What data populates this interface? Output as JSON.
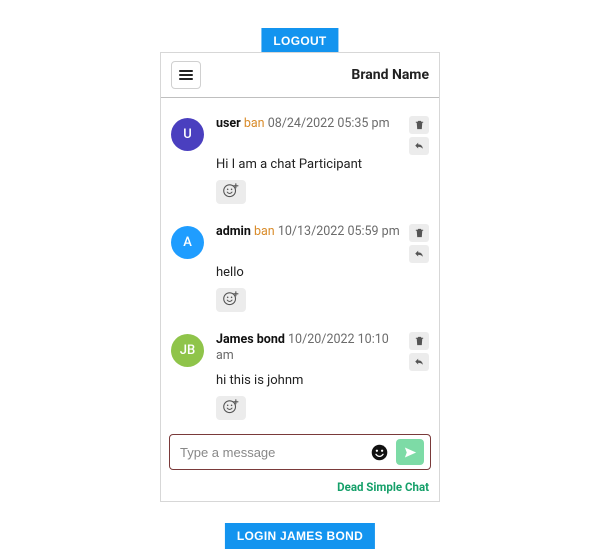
{
  "logout_label": "LOGOUT",
  "login_label": "LOGIN JAMES BOND",
  "brand": "Brand Name",
  "composer": {
    "placeholder": "Type a message"
  },
  "footer_link": "Dead Simple Chat",
  "ban_label": "ban",
  "avatar_colors": {
    "u": "#4a3fbf",
    "a": "#1f9dff",
    "jb": "#8fc44a"
  },
  "messages": [
    {
      "initials": "U",
      "avatar_key": "u",
      "username": "user",
      "show_ban": true,
      "timestamp": "08/24/2022 05:35 pm",
      "text": "Hi I am a chat Participant"
    },
    {
      "initials": "A",
      "avatar_key": "a",
      "username": "admin",
      "show_ban": true,
      "timestamp": "10/13/2022 05:59 pm",
      "text": "hello"
    },
    {
      "initials": "JB",
      "avatar_key": "jb",
      "username": "James bond",
      "show_ban": false,
      "timestamp": "10/20/2022 10:10 am",
      "text": "hi this is johnm"
    }
  ]
}
